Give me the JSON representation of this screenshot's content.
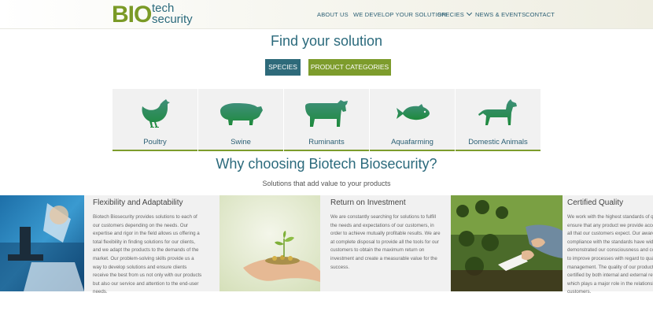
{
  "header": {
    "logo": {
      "bio": "BIO",
      "tech": "tech",
      "security": "security"
    },
    "nav": [
      {
        "label": "ABOUT US"
      },
      {
        "label": "WE DEVELOP YOUR SOLUTION"
      },
      {
        "label": "SPECIES"
      },
      {
        "label": "NEWS & EVENTS"
      },
      {
        "label": "CONTACT"
      }
    ]
  },
  "find": {
    "title": "Find your solution",
    "tabs": [
      {
        "label": "SPECIES",
        "color": "#2e6a7a"
      },
      {
        "label": "PRODUCT CATEGORIES",
        "color": "#7d9c2c"
      }
    ]
  },
  "species": [
    {
      "label": "Poultry",
      "icon": "poultry-icon"
    },
    {
      "label": "Swine",
      "icon": "swine-icon"
    },
    {
      "label": "Ruminants",
      "icon": "cow-icon"
    },
    {
      "label": "Aquafarming",
      "icon": "fish-icon"
    },
    {
      "label": "Domestic Animals",
      "icon": "dog-icon"
    }
  ],
  "why": {
    "title": "Why choosing Biotech Biosecurity?",
    "subtitle": "Solutions that add value to your products"
  },
  "features": [
    {
      "title": "Flexibility and Adaptability",
      "image": "lab-scientist-photo",
      "body": "Biotech Biosecurity provides solutions to each of our customers depending on the needs. Our expertise and rigor in the field allows us offering a total flexibility in finding solutions for our clients, and we adapt the products to the demands of the market. Our problem-solving skills provide us a way to develop solutions and ensure clients receive the best from us not only with our products but also our service and attention to the end-user needs."
    },
    {
      "title": "Return on Investment",
      "image": "hand-plant-coins-photo",
      "body": "We are constantly searching for solutions to fulfill the needs and expectations of our customers, in order to achieve mutually profitable results. We are at complete disposal to provide all the tools for our customers to obtain the maximum return on investment and create a measurable value for the success."
    },
    {
      "title": "Certified Quality",
      "image": "seedlings-inspection-photo",
      "body": "We work with the highest standards of quality to ensure that any product we provide accomplishes all that our customers expect. Our awareness and compliance with the standards have widely demonstrated our consciousness and commitment to improve processes with regard to quality and management. The quality of our products is also certified by both internal and external reviews, which plays a major role in the relationship with our customers."
    }
  ],
  "colors": {
    "teal": "#2b6a7c",
    "green": "#7d9c2c",
    "card_bg": "#f1f1f1"
  }
}
